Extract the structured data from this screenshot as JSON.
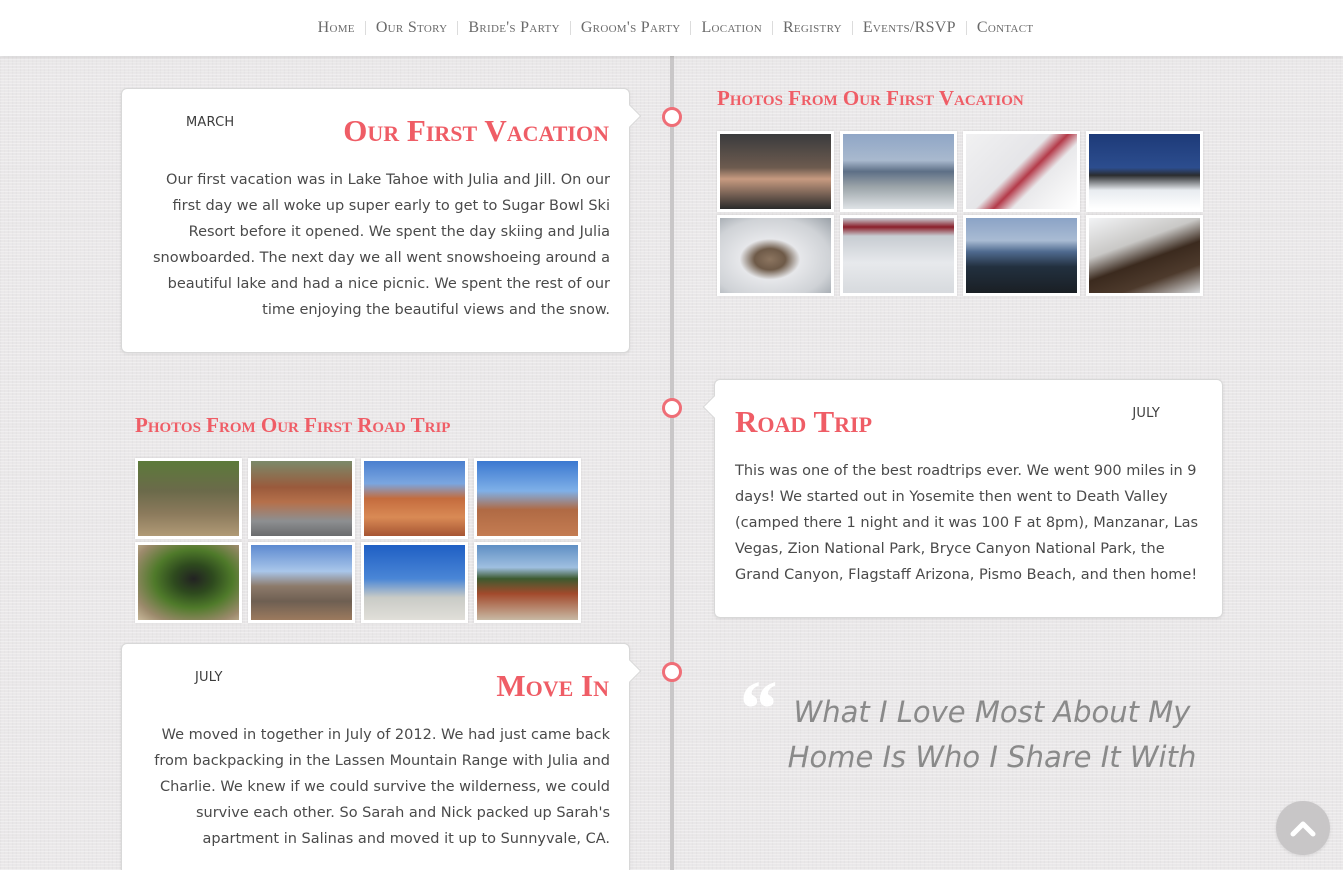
{
  "nav": {
    "items": [
      "Home",
      "Our Story",
      "Bride's Party",
      "Groom's Party",
      "Location",
      "Registry",
      "Events/RSVP",
      "Contact"
    ]
  },
  "story": [
    {
      "month": "MARCH",
      "title": "Our First Vacation",
      "body": "Our first vacation was in Lake Tahoe with Julia and Jill. On our first day we all woke up super early to get to Sugar Bowl Ski Resort before it opened. We spent the day skiing and Julia snowboarded. The next day we all went snowshoeing around a beautiful lake and had a nice picnic. We spent the rest of our time enjoying the beautiful views and the snow."
    },
    {
      "month": "JULY",
      "title": "Road Trip",
      "body": "This was one of the best roadtrips ever. We went 900 miles in 9 days! We started out in Yosemite then went to Death Valley (camped there 1 night and it was 100 F at 8pm), Manzanar, Las Vegas, Zion National Park, Bryce Canyon National Park, the Grand Canyon, Flagstaff Arizona, Pismo Beach, and then home!"
    },
    {
      "month": "JULY",
      "title": "Move In",
      "body": "We moved in together in July of 2012. We had just came back from backpacking in the Lassen Mountain Range with Julia and Charlie. We knew if we could survive the wilderness, we could survive each other. So Sarah and Nick packed up Sarah's apartment in Salinas and moved it up to Sunnyvale, CA."
    }
  ],
  "galleries": {
    "vacation_title": "Photos From Our First Vacation",
    "roadtrip_title": "Photos From Our First Road Trip"
  },
  "quote": {
    "mark": "“",
    "text": "What I Love Most About My Home Is Who I Share It With"
  },
  "colors": {
    "accent": "#ef5d66",
    "dot_border": "#ef6e77",
    "timeline": "#c9c7c8",
    "quote_text": "#8a8a8a"
  },
  "icons": {
    "back_to_top": "chevron-up-icon",
    "quote": "quote-mark-icon"
  }
}
